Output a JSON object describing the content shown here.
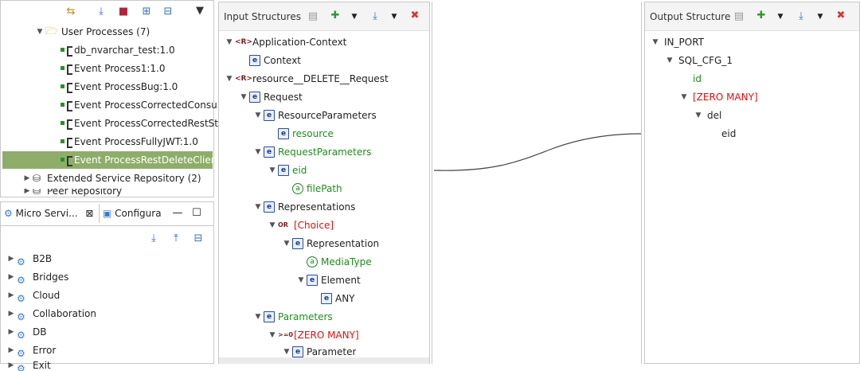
{
  "navigator": {
    "folder_label": "User Processes (7)",
    "processes": [
      "db_nvarchar_test:1.0",
      "Event Process1:1.0",
      "Event ProcessBug:1.0",
      "Event ProcessCorrectedConsu",
      "Event ProcessCorrectedRestSt",
      "Event ProcessFullyJWT:1.0",
      "Event ProcessRestDeleteClient"
    ],
    "extended_repo": "Extended Service Repository (2)",
    "peer_repo": "Peer Repository"
  },
  "micro_panel": {
    "tab1": "Micro Servi...",
    "tab2": "Configura",
    "items": [
      "B2B",
      "Bridges",
      "Cloud",
      "Collaboration",
      "DB",
      "Error",
      "Exit"
    ]
  },
  "input": {
    "title": "Input Structures",
    "tree": [
      {
        "t": "Application-Context",
        "icon": "R",
        "lvl": 0,
        "tw": "▼",
        "c": ""
      },
      {
        "t": "Context",
        "icon": "e",
        "lvl": 1,
        "tw": "",
        "c": ""
      },
      {
        "t": "resource__DELETE__Request",
        "icon": "R",
        "lvl": 0,
        "tw": "▼",
        "c": ""
      },
      {
        "t": "Request",
        "icon": "e",
        "lvl": 1,
        "tw": "▼",
        "c": ""
      },
      {
        "t": "ResourceParameters",
        "icon": "e",
        "lvl": 2,
        "tw": "▼",
        "c": ""
      },
      {
        "t": "resource",
        "icon": "e",
        "lvl": 3,
        "tw": "",
        "c": "green"
      },
      {
        "t": "RequestParameters",
        "icon": "e",
        "lvl": 2,
        "tw": "▼",
        "c": "green"
      },
      {
        "t": "eid",
        "icon": "e",
        "lvl": 3,
        "tw": "▼",
        "c": "green"
      },
      {
        "t": "filePath",
        "icon": "a",
        "lvl": 4,
        "tw": "",
        "c": "green"
      },
      {
        "t": "Representations",
        "icon": "e",
        "lvl": 2,
        "tw": "▼",
        "c": ""
      },
      {
        "t": "[Choice]",
        "icon": "OR",
        "lvl": 3,
        "tw": "▼",
        "c": "red"
      },
      {
        "t": "Representation",
        "icon": "e",
        "lvl": 4,
        "tw": "▼",
        "c": ""
      },
      {
        "t": "MediaType",
        "icon": "a",
        "lvl": 5,
        "tw": "",
        "c": "green"
      },
      {
        "t": "Element",
        "icon": "e",
        "lvl": 5,
        "tw": "▼",
        "c": ""
      },
      {
        "t": "ANY",
        "icon": "e",
        "lvl": 6,
        "tw": "",
        "c": ""
      },
      {
        "t": "Parameters",
        "icon": "e",
        "lvl": 2,
        "tw": "▼",
        "c": "green"
      },
      {
        "t": "[ZERO MANY]",
        "icon": ">=0",
        "lvl": 3,
        "tw": "▼",
        "c": "red"
      },
      {
        "t": "Parameter",
        "icon": "e",
        "lvl": 4,
        "tw": "▼",
        "c": ""
      }
    ]
  },
  "output": {
    "title": "Output Structure",
    "tree": [
      {
        "t": "IN_PORT",
        "lvl": 0,
        "tw": "▼",
        "c": ""
      },
      {
        "t": "SQL_CFG_1",
        "lvl": 1,
        "tw": "▼",
        "c": ""
      },
      {
        "t": "id",
        "lvl": 2,
        "tw": "",
        "c": "green"
      },
      {
        "t": "[ZERO MANY]",
        "lvl": 2,
        "tw": "▼",
        "c": "red"
      },
      {
        "t": "del",
        "lvl": 3,
        "tw": "▼",
        "c": ""
      },
      {
        "t": "eid",
        "lvl": 4,
        "tw": "",
        "c": ""
      }
    ]
  },
  "colors": {
    "selection": "#8fad6a",
    "green": "#1f8b1f",
    "red": "#dd1111",
    "accent": "#3a7dc9"
  }
}
